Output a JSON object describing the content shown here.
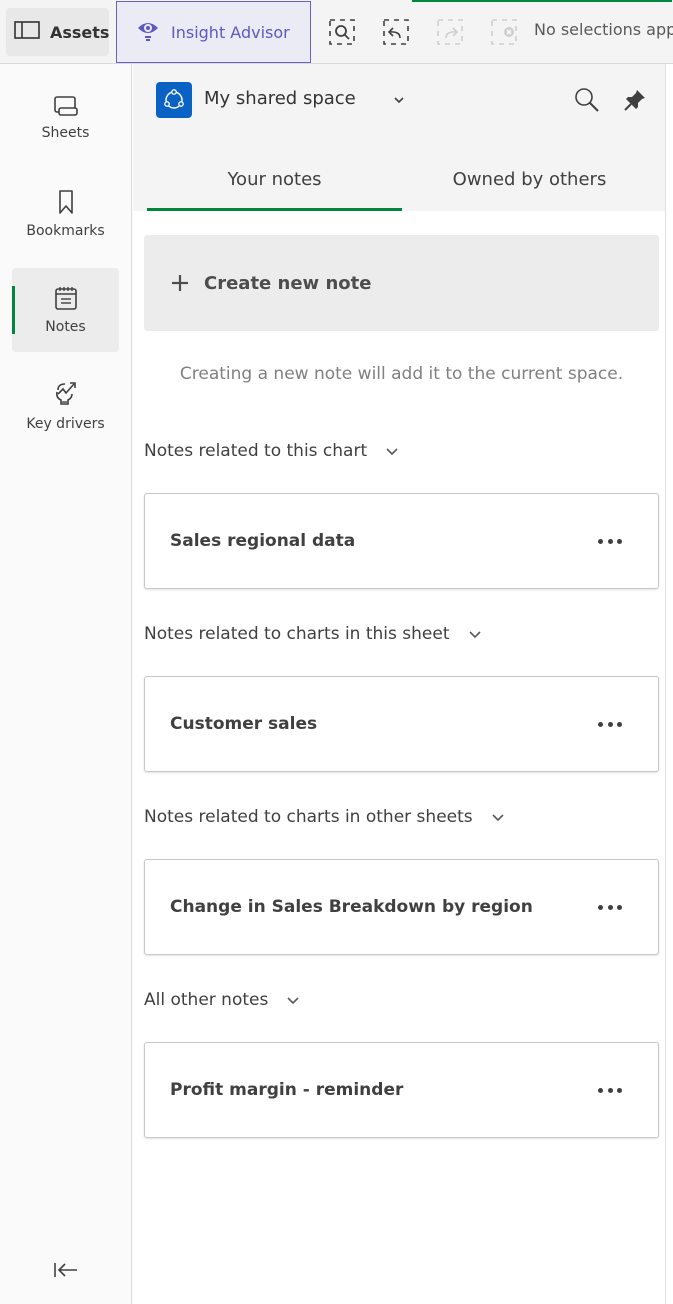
{
  "toolbar": {
    "assets_label": "Assets",
    "insight_label": "Insight Advisor",
    "selection_status": "No selections appl",
    "tools": [
      {
        "name": "smart-search",
        "enabled": true
      },
      {
        "name": "step-back",
        "enabled": true
      },
      {
        "name": "step-forward",
        "enabled": false
      },
      {
        "name": "clear-selections",
        "enabled": false
      }
    ]
  },
  "sidebar": {
    "items": [
      {
        "label": "Sheets",
        "icon": "sheets-icon",
        "active": false
      },
      {
        "label": "Bookmarks",
        "icon": "bookmark-icon",
        "active": false
      },
      {
        "label": "Notes",
        "icon": "notes-icon",
        "active": true
      },
      {
        "label": "Key drivers",
        "icon": "key-drivers-icon",
        "active": false
      }
    ],
    "collapse_icon": "collapse-left-icon"
  },
  "panel": {
    "space_name": "My shared space",
    "tabs": [
      {
        "label": "Your notes",
        "active": true
      },
      {
        "label": "Owned by others",
        "active": false
      }
    ],
    "create_label": "Create new note",
    "hint": "Creating a new note will add it to the current space.",
    "sections": [
      {
        "title": "Notes related to this chart",
        "notes": [
          "Sales regional data"
        ]
      },
      {
        "title": "Notes related to charts in this sheet",
        "notes": [
          "Customer sales"
        ]
      },
      {
        "title": "Notes related to charts in other sheets",
        "notes": [
          "Change in Sales Breakdown by region"
        ]
      },
      {
        "title": "All other notes",
        "notes": [
          "Profit margin - reminder"
        ]
      }
    ]
  },
  "colors": {
    "accent_green": "#00873d",
    "insight_purple": "#5f58c2",
    "space_blue": "#0a63c4"
  }
}
